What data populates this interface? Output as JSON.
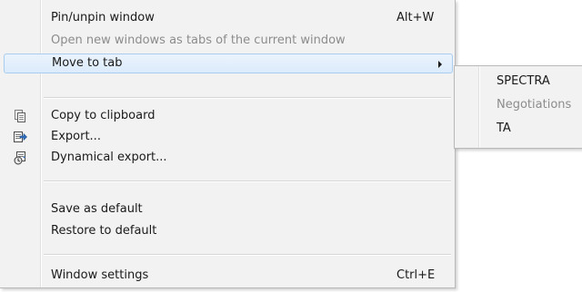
{
  "main_menu": {
    "items": [
      {
        "label": "Pin/unpin window",
        "shortcut": "Alt+W",
        "enabled": true
      },
      {
        "label": "Open new windows as tabs of the current window",
        "shortcut": "",
        "enabled": false
      },
      {
        "label": "Move to tab",
        "shortcut": "",
        "enabled": true,
        "has_submenu": true,
        "highlighted": true
      },
      {
        "label": "Copy to clipboard",
        "shortcut": "",
        "enabled": true,
        "icon": "copy-icon"
      },
      {
        "label": "Export...",
        "shortcut": "",
        "enabled": true,
        "icon": "export-icon"
      },
      {
        "label": "Dynamical export...",
        "shortcut": "",
        "enabled": true,
        "icon": "dynamic-export-icon"
      },
      {
        "label": "Save as default",
        "shortcut": "",
        "enabled": true
      },
      {
        "label": "Restore to default",
        "shortcut": "",
        "enabled": true
      },
      {
        "label": "Window settings",
        "shortcut": "Ctrl+E",
        "enabled": true
      }
    ]
  },
  "sub_menu": {
    "items": [
      {
        "label": "SPECTRA",
        "enabled": true
      },
      {
        "label": "Negotiations",
        "enabled": false
      },
      {
        "label": "TA",
        "enabled": true
      }
    ]
  },
  "colors": {
    "menu_background": "#f2f2f2",
    "highlight_background": "#dcebfb",
    "highlight_border": "#a9cdf0",
    "disabled_text": "#8c8c8c"
  }
}
